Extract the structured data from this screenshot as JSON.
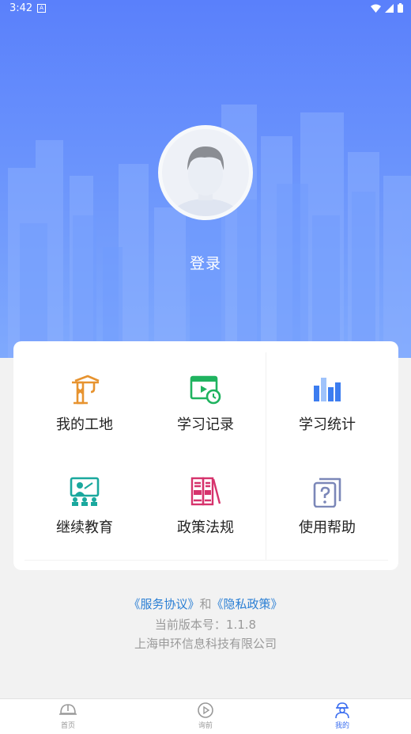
{
  "status_bar": {
    "time": "3:42",
    "notification": "A"
  },
  "profile": {
    "login_label": "登录"
  },
  "menu": [
    {
      "label": "我的工地",
      "icon": "crane-icon"
    },
    {
      "label": "学习记录",
      "icon": "video-record-icon"
    },
    {
      "label": "学习统计",
      "icon": "bar-chart-icon"
    },
    {
      "label": "继续教育",
      "icon": "teaching-board-icon"
    },
    {
      "label": "政策法规",
      "icon": "law-books-icon"
    },
    {
      "label": "使用帮助",
      "icon": "help-question-icon"
    }
  ],
  "footer": {
    "service_agreement": "《服务协议》",
    "and": "和",
    "privacy_policy": "《隐私政策》",
    "version": "当前版本号：1.1.8",
    "company": "上海申环信息科技有限公司"
  },
  "tabbar": [
    {
      "label": "首页",
      "icon": "helmet-icon",
      "active": false
    },
    {
      "label": "询前",
      "icon": "play-circle-icon",
      "active": false
    },
    {
      "label": "我的",
      "icon": "worker-person-icon",
      "active": true
    }
  ],
  "colors": {
    "hero_top": "#5a80fb",
    "hero_bottom": "#7fa9fd",
    "active_tab": "#3b6ef0",
    "link": "#2b7fd4"
  }
}
